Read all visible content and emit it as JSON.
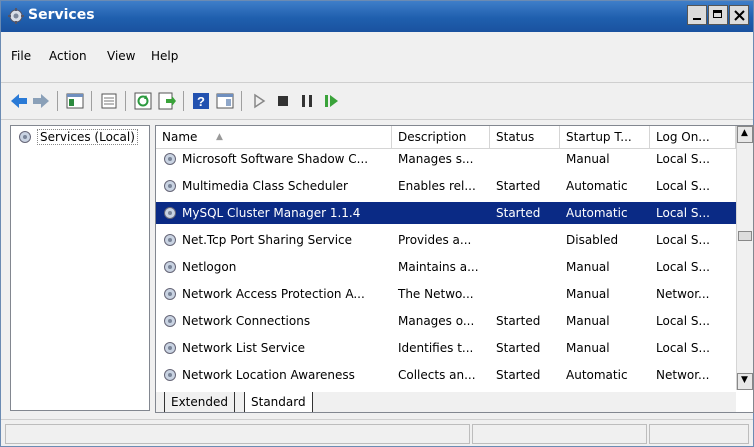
{
  "window": {
    "title": "Services"
  },
  "menu": [
    "File",
    "Action",
    "View",
    "Help"
  ],
  "toolbar": {
    "icons": [
      "back-icon",
      "forward-icon",
      "show-hide-console-tree-icon",
      "properties-icon",
      "refresh-icon",
      "export-list-icon",
      "help-icon",
      "show-hide-action-pane-icon",
      "start-service-icon",
      "stop-service-icon",
      "pause-service-icon",
      "resume-service-icon"
    ]
  },
  "left_pane": {
    "node_label": "Services (Local)"
  },
  "table": {
    "columns": [
      "Name",
      "Description",
      "Status",
      "Startup T...",
      "Log On..."
    ],
    "rows": [
      {
        "name": "Microsoft Software Shadow C...",
        "description": "Manages s...",
        "status": "",
        "startup": "Manual",
        "logon": "Local S..."
      },
      {
        "name": "Multimedia Class Scheduler",
        "description": "Enables rel...",
        "status": "Started",
        "startup": "Automatic",
        "logon": "Local S..."
      },
      {
        "name": "MySQL Cluster Manager 1.1.4",
        "description": "",
        "status": "Started",
        "startup": "Automatic",
        "logon": "Local S...",
        "selected": true
      },
      {
        "name": "Net.Tcp Port Sharing Service",
        "description": "Provides a...",
        "status": "",
        "startup": "Disabled",
        "logon": "Local S..."
      },
      {
        "name": "Netlogon",
        "description": "Maintains a...",
        "status": "",
        "startup": "Manual",
        "logon": "Local S..."
      },
      {
        "name": "Network Access Protection A...",
        "description": "The Netwo...",
        "status": "",
        "startup": "Manual",
        "logon": "Networ..."
      },
      {
        "name": "Network Connections",
        "description": "Manages o...",
        "status": "Started",
        "startup": "Manual",
        "logon": "Local S..."
      },
      {
        "name": "Network List Service",
        "description": "Identifies t...",
        "status": "Started",
        "startup": "Manual",
        "logon": "Local S..."
      },
      {
        "name": "Network Location Awareness",
        "description": "Collects an...",
        "status": "Started",
        "startup": "Automatic",
        "logon": "Networ..."
      }
    ]
  },
  "tabs": [
    "Extended",
    "Standard"
  ],
  "colors": {
    "title_bar": "#1f5fae",
    "selection": "#0a2a85"
  }
}
